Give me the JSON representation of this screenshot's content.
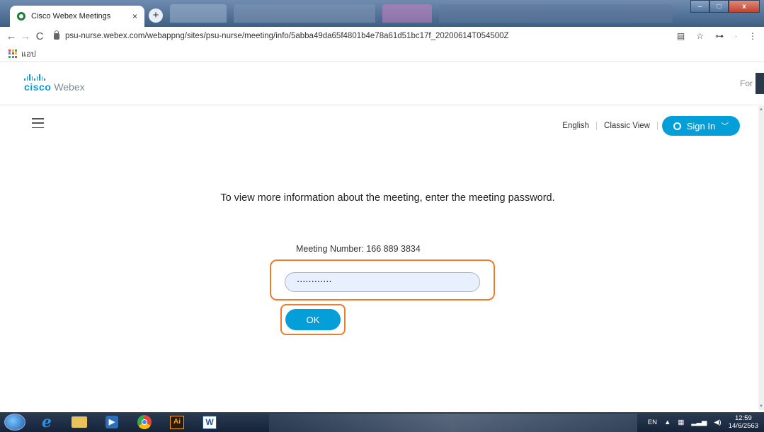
{
  "browser": {
    "tab_title": "Cisco Webex Meetings",
    "tab_close": "×",
    "new_tab": "+",
    "url": "psu-nurse.webex.com/webappng/sites/psu-nurse/meeting/info/5abba49da65f4801b4e78a61d51bc17f_20200614T054500Z",
    "bookmark_apps_label": "แอป",
    "window_buttons": [
      "–",
      "□",
      "x"
    ],
    "nav_icons": [
      "back-icon",
      "forward-icon",
      "reload-icon"
    ]
  },
  "header": {
    "logo_brand": "cisco",
    "logo_product": "Webex",
    "right_text": "For"
  },
  "topnav": {
    "language": "English",
    "classic_view": "Classic View",
    "sign_in": "Sign In"
  },
  "main": {
    "prompt": "To view more information about the meeting, enter the meeting password.",
    "meeting_number": "Meeting Number: 166 889 3834",
    "password_value": "············",
    "ok_label": "OK"
  },
  "taskbar": {
    "language": "EN",
    "time": "12:59",
    "date": "14/6/2563",
    "apps": [
      "start-orb",
      "internet-explorer-icon",
      "file-explorer-icon",
      "media-player-icon",
      "chrome-icon",
      "illustrator-icon",
      "word-icon"
    ]
  },
  "colors": {
    "webex_blue": "#049fd9",
    "highlight_orange": "#ee7a2b"
  }
}
